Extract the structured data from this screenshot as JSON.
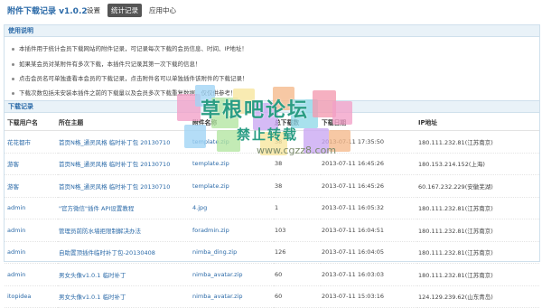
{
  "header": {
    "title": "附件下载记录 v1.0.2",
    "nav": [
      {
        "label": "设置",
        "active": false
      },
      {
        "label": "统计记录",
        "active": true
      },
      {
        "label": "应用中心",
        "active": false
      }
    ]
  },
  "notes": {
    "title": "使用说明",
    "items": [
      "本插件用于统计会员下载网站的附件记录，可记录每次下载的会员信息、时间、IP地址！",
      "如果某会员对某附件有多次下载，本插件只记录其第一次下载的信息！",
      "点击会员名可单独查看本会员的下载记录，点击附件名可以单独插件该附件的下载记录！",
      "下载次数包括未安装本插件之前的下载量以及会员多次下载重复数据，仅仅供参考！"
    ]
  },
  "records": {
    "title": "下载记录",
    "columns": [
      "下载用户名",
      "所在主题",
      "附件名称",
      "总下载数",
      "下载日期",
      "IP地址"
    ],
    "rows": [
      {
        "user": "花花都市",
        "topic": "首页N格_通灵风格 临时补丁包 20130710",
        "file": "template.zip",
        "count": "38",
        "date": "2013-07-11 17:35:50",
        "ip": "180.111.232.81(江苏南京)"
      },
      {
        "user": "游客",
        "topic": "首页N格_通灵风格 临时补丁包 20130710",
        "file": "template.zip",
        "count": "38",
        "date": "2013-07-11 16:45:26",
        "ip": "180.153.214.152(上海)"
      },
      {
        "user": "游客",
        "topic": "首页N格_通灵风格 临时补丁包 20130710",
        "file": "template.zip",
        "count": "38",
        "date": "2013-07-11 16:45:26",
        "ip": "60.167.232.229(安徽芜湖)"
      },
      {
        "user": "admin",
        "topic": "\"官方微信\"插件 API设置教程",
        "file": "4.jpg",
        "count": "1",
        "date": "2013-07-11 16:05:32",
        "ip": "180.111.232.81(江苏南京)"
      },
      {
        "user": "admin",
        "topic": "管理员前防水墙拒限制解决办法",
        "file": "foradmin.zip",
        "count": "103",
        "date": "2013-07-11 16:04:51",
        "ip": "180.111.232.81(江苏南京)"
      },
      {
        "user": "admin",
        "topic": "自助置顶插件临时补丁包-20130408",
        "file": "nimba_ding.zip",
        "count": "126",
        "date": "2013-07-11 16:04:05",
        "ip": "180.111.232.81(江苏南京)"
      },
      {
        "user": "admin",
        "topic": "男女头像v1.0.1 临时补丁",
        "file": "nimba_avatar.zip",
        "count": "60",
        "date": "2013-07-11 16:03:03",
        "ip": "180.111.232.81(江苏南京)"
      },
      {
        "user": "itopidea",
        "topic": "男女头像v1.0.1 临时补丁",
        "file": "nimba_avatar.zip",
        "count": "60",
        "date": "2013-07-11 15:03:16",
        "ip": "124.129.239.62(山东青岛)"
      }
    ]
  },
  "watermark": {
    "title": "草根吧论坛",
    "subtitle": "禁止转载",
    "url": "www.cgzz8.com",
    "colors": [
      "#f2a0c8",
      "#9fd3f5",
      "#b2e6a0",
      "#f7e59c",
      "#c9a7f2",
      "#f5b98a",
      "#8fd9e8",
      "#f39ab0"
    ]
  }
}
